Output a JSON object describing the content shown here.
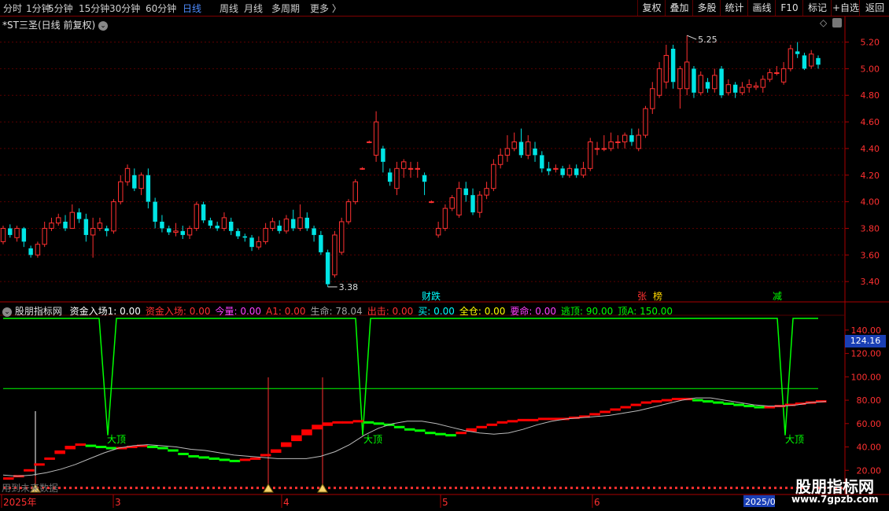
{
  "toolbar": {
    "left_tabs": [
      {
        "label": "分时",
        "active": false
      },
      {
        "label": "1分钟",
        "active": false
      },
      {
        "label": "5分钟",
        "active": false
      },
      {
        "label": "15分钟",
        "active": false
      },
      {
        "label": "30分钟",
        "active": false
      },
      {
        "label": "60分钟",
        "active": false
      },
      {
        "label": "日线",
        "active": true
      },
      {
        "label": "周线",
        "active": false
      },
      {
        "label": "月线",
        "active": false
      },
      {
        "label": "多周期",
        "active": false
      },
      {
        "label": "更多 〉",
        "active": false
      }
    ],
    "right_buttons": [
      "复权",
      "叠加",
      "多股",
      "统计",
      "画线",
      "F10",
      "标记",
      "+自选",
      "返回"
    ]
  },
  "stock": {
    "title": "*ST三圣(日线 前复权)",
    "high_label": "5.25",
    "low_label": "3.38",
    "price_ticks": [
      "5.20",
      "5.00",
      "4.80",
      "4.60",
      "4.40",
      "4.20",
      "4.00",
      "3.80",
      "3.60",
      "3.40"
    ]
  },
  "event_markers": [
    {
      "label": "财",
      "color": "#00ffff"
    },
    {
      "label": "跌",
      "color": "#00ffff"
    },
    {
      "label": "张",
      "color": "#ff3030"
    },
    {
      "label": "榜",
      "color": "#ffd700"
    },
    {
      "label": "减",
      "color": "#00ff00"
    }
  ],
  "indicator": {
    "name": "股朋指标网",
    "fields": [
      {
        "label": "资金入场1: 0.00",
        "color": "#ffffff"
      },
      {
        "label": "资金入场: 0.00",
        "color": "#ff3030"
      },
      {
        "label": "今量: 0.00",
        "color": "#ff40ff"
      },
      {
        "label": "A1: 0.00",
        "color": "#ff3030"
      },
      {
        "label": "生命: 78.04",
        "color": "#a0a0a0"
      },
      {
        "label": "出击: 0.00",
        "color": "#ff3030"
      },
      {
        "label": "买: 0.00",
        "color": "#00ffff"
      },
      {
        "label": "全仓: 0.00",
        "color": "#ffff00"
      },
      {
        "label": "要命: 0.00",
        "color": "#ff40ff"
      },
      {
        "label": "逃顶: 90.00",
        "color": "#00ff00"
      },
      {
        "label": "顶A: 150.00",
        "color": "#00ff00"
      }
    ],
    "value_ticks": [
      "140.00",
      "120.00",
      "100.00",
      "80.00",
      "60.00",
      "40.00",
      "20.00"
    ],
    "current_value": "124.16",
    "top_signal_label": "大顶"
  },
  "time_axis": {
    "labels": [
      "2025年",
      "3",
      "4",
      "5",
      "6"
    ],
    "right_label": "2025/0",
    "hint_text": "用到未来数据"
  },
  "watermark": {
    "title": "股朋指标网",
    "url": "www.7gpzb.com"
  },
  "colors": {
    "up": "#ff3030",
    "down": "#00e5e5",
    "indicator_up": "#ff0000",
    "indicator_down": "#00ff00",
    "frame": "#aa0000",
    "active_tab": "#4f8cff"
  },
  "chart_data": {
    "type": "candlestick",
    "title": "*ST三圣(日线 前复权)",
    "ylim": [
      3.33,
      5.28
    ],
    "candles": [
      [
        3.7,
        3.8,
        3.82,
        3.68
      ],
      [
        3.8,
        3.75,
        3.83,
        3.73
      ],
      [
        3.73,
        3.8,
        3.82,
        3.7
      ],
      [
        3.8,
        3.7,
        3.81,
        3.66
      ],
      [
        3.65,
        3.6,
        3.67,
        3.58
      ],
      [
        3.6,
        3.68,
        3.7,
        3.58
      ],
      [
        3.68,
        3.8,
        3.85,
        3.66
      ],
      [
        3.8,
        3.84,
        3.88,
        3.78
      ],
      [
        3.84,
        3.88,
        3.91,
        3.82
      ],
      [
        3.85,
        3.8,
        3.9,
        3.78
      ],
      [
        3.8,
        3.92,
        3.98,
        3.8
      ],
      [
        3.92,
        3.87,
        3.95,
        3.84
      ],
      [
        3.87,
        3.75,
        3.91,
        3.7
      ],
      [
        3.75,
        3.8,
        3.88,
        3.58
      ],
      [
        3.8,
        3.84,
        3.88,
        3.78
      ],
      [
        3.8,
        3.78,
        3.82,
        3.74
      ],
      [
        3.78,
        4.0,
        4.02,
        3.76
      ],
      [
        4.0,
        4.15,
        4.2,
        3.98
      ],
      [
        4.15,
        4.25,
        4.28,
        4.12
      ],
      [
        4.2,
        4.1,
        4.25,
        4.08
      ],
      [
        4.1,
        4.2,
        4.22,
        4.05
      ],
      [
        4.2,
        4.0,
        4.25,
        3.95
      ],
      [
        4.0,
        3.85,
        4.03,
        3.8
      ],
      [
        3.85,
        3.8,
        3.9,
        3.77
      ],
      [
        3.8,
        3.77,
        3.82,
        3.75
      ],
      [
        3.77,
        3.78,
        3.84,
        3.74
      ],
      [
        3.78,
        3.75,
        3.82,
        3.72
      ],
      [
        3.75,
        3.8,
        3.82,
        3.72
      ],
      [
        3.8,
        3.98,
        4.0,
        3.78
      ],
      [
        3.98,
        3.86,
        4.0,
        3.84
      ],
      [
        3.86,
        3.82,
        3.88,
        3.8
      ],
      [
        3.82,
        3.8,
        3.85,
        3.78
      ],
      [
        3.8,
        3.88,
        3.92,
        3.78
      ],
      [
        3.85,
        3.78,
        3.88,
        3.75
      ],
      [
        3.78,
        3.74,
        3.8,
        3.72
      ],
      [
        3.74,
        3.73,
        3.76,
        3.7
      ],
      [
        3.73,
        3.66,
        3.75,
        3.63
      ],
      [
        3.66,
        3.7,
        3.74,
        3.64
      ],
      [
        3.7,
        3.8,
        3.84,
        3.68
      ],
      [
        3.8,
        3.85,
        3.88,
        3.78
      ],
      [
        3.82,
        3.78,
        3.86,
        3.76
      ],
      [
        3.78,
        3.87,
        3.9,
        3.76
      ],
      [
        3.87,
        3.8,
        3.94,
        3.78
      ],
      [
        3.8,
        3.88,
        3.98,
        3.78
      ],
      [
        3.88,
        3.8,
        3.92,
        3.78
      ],
      [
        3.8,
        3.75,
        3.82,
        3.7
      ],
      [
        3.75,
        3.62,
        3.78,
        3.6
      ],
      [
        3.62,
        3.38,
        3.64,
        3.36
      ],
      [
        3.45,
        3.75,
        3.78,
        3.43
      ],
      [
        3.62,
        3.85,
        3.88,
        3.6
      ],
      [
        3.85,
        4.0,
        4.02,
        3.83
      ],
      [
        4.0,
        4.15,
        4.17,
        3.98
      ],
      [
        4.25,
        4.25,
        4.26,
        4.24
      ],
      [
        4.45,
        4.45,
        4.46,
        4.44
      ],
      [
        4.35,
        4.6,
        4.68,
        4.3
      ],
      [
        4.4,
        4.3,
        4.42,
        4.22
      ],
      [
        4.22,
        4.15,
        4.25,
        4.12
      ],
      [
        4.1,
        4.25,
        4.3,
        4.05
      ],
      [
        4.25,
        4.3,
        4.32,
        4.18
      ],
      [
        4.25,
        4.25,
        4.3,
        4.18
      ],
      [
        4.25,
        4.25,
        4.3,
        4.18
      ],
      [
        4.2,
        4.15,
        4.22,
        4.05
      ],
      [
        4.0,
        4.0,
        4.01,
        3.99
      ],
      [
        3.75,
        3.8,
        3.85,
        3.73
      ],
      [
        3.8,
        3.95,
        3.98,
        3.78
      ],
      [
        3.95,
        4.03,
        4.05,
        3.93
      ],
      [
        3.9,
        4.1,
        4.15,
        3.88
      ],
      [
        4.1,
        4.05,
        4.15,
        4.0
      ],
      [
        4.05,
        3.92,
        4.1,
        3.9
      ],
      [
        3.92,
        4.05,
        4.08,
        3.88
      ],
      [
        4.05,
        4.1,
        4.15,
        4.02
      ],
      [
        4.1,
        4.28,
        4.32,
        4.08
      ],
      [
        4.28,
        4.35,
        4.4,
        4.25
      ],
      [
        4.35,
        4.4,
        4.5,
        4.3
      ],
      [
        4.4,
        4.45,
        4.52,
        4.38
      ],
      [
        4.45,
        4.35,
        4.55,
        4.33
      ],
      [
        4.35,
        4.45,
        4.5,
        4.32
      ],
      [
        4.4,
        4.35,
        4.45,
        4.3
      ],
      [
        4.35,
        4.25,
        4.38,
        4.22
      ],
      [
        4.25,
        4.23,
        4.3,
        4.2
      ],
      [
        4.25,
        4.25,
        4.28,
        4.22
      ],
      [
        4.25,
        4.2,
        4.27,
        4.18
      ],
      [
        4.2,
        4.25,
        4.28,
        4.18
      ],
      [
        4.25,
        4.2,
        4.28,
        4.18
      ],
      [
        4.2,
        4.25,
        4.3,
        4.18
      ],
      [
        4.25,
        4.45,
        4.48,
        4.23
      ],
      [
        4.4,
        4.4,
        4.45,
        4.35
      ],
      [
        4.4,
        4.4,
        4.5,
        4.38
      ],
      [
        4.4,
        4.45,
        4.52,
        4.38
      ],
      [
        4.45,
        4.45,
        4.5,
        4.4
      ],
      [
        4.45,
        4.5,
        4.52,
        4.4
      ],
      [
        4.5,
        4.45,
        4.55,
        4.42
      ],
      [
        4.4,
        4.5,
        4.55,
        4.38
      ],
      [
        4.5,
        4.7,
        4.72,
        4.48
      ],
      [
        4.7,
        4.85,
        4.9,
        4.66
      ],
      [
        4.8,
        5.0,
        5.05,
        4.78
      ],
      [
        4.9,
        5.1,
        5.18,
        4.85
      ],
      [
        5.15,
        4.9,
        5.18,
        4.85
      ],
      [
        4.85,
        5.0,
        5.02,
        4.7
      ],
      [
        4.85,
        5.05,
        5.25,
        4.8
      ],
      [
        5.0,
        4.82,
        5.02,
        4.78
      ],
      [
        4.82,
        4.95,
        4.98,
        4.8
      ],
      [
        4.9,
        4.85,
        4.93,
        4.82
      ],
      [
        4.85,
        4.95,
        5.0,
        4.82
      ],
      [
        5.0,
        4.8,
        5.02,
        4.78
      ],
      [
        4.82,
        4.88,
        4.92,
        4.8
      ],
      [
        4.88,
        4.82,
        4.9,
        4.78
      ],
      [
        4.82,
        4.86,
        4.9,
        4.8
      ],
      [
        4.86,
        4.88,
        4.92,
        4.82
      ],
      [
        4.86,
        4.87,
        4.9,
        4.84
      ],
      [
        4.86,
        4.92,
        4.95,
        4.82
      ],
      [
        4.92,
        4.97,
        5.0,
        4.9
      ],
      [
        4.97,
        4.97,
        5.02,
        4.95
      ],
      [
        4.9,
        5.0,
        5.05,
        4.88
      ],
      [
        5.0,
        5.15,
        5.18,
        4.98
      ],
      [
        5.13,
        5.11,
        5.2,
        5.08
      ],
      [
        5.1,
        5.0,
        5.12,
        4.99
      ],
      [
        5.02,
        5.11,
        5.14,
        5.0
      ],
      [
        5.08,
        5.03,
        5.1,
        5.0
      ]
    ],
    "indicator_ylim": [
      0,
      150
    ],
    "indicator_step": [
      [
        14,
        14
      ],
      [
        16,
        16
      ],
      [
        20,
        21
      ],
      [
        24,
        26
      ],
      [
        29,
        31
      ],
      [
        34,
        37
      ],
      [
        38,
        41
      ],
      [
        42,
        43
      ],
      [
        41,
        42
      ],
      [
        40,
        41
      ],
      [
        39,
        40
      ],
      [
        38,
        40
      ],
      [
        40,
        41
      ],
      [
        41,
        42
      ],
      [
        40,
        41
      ],
      [
        39,
        40
      ],
      [
        37,
        38
      ],
      [
        34,
        35
      ],
      [
        32,
        33
      ],
      [
        31,
        32
      ],
      [
        30,
        31
      ],
      [
        29,
        30
      ],
      [
        28,
        29
      ],
      [
        29,
        30
      ],
      [
        30,
        31
      ],
      [
        32,
        34
      ],
      [
        35,
        38
      ],
      [
        40,
        44
      ],
      [
        45,
        50
      ],
      [
        50,
        55
      ],
      [
        55,
        59
      ],
      [
        58,
        61
      ],
      [
        60,
        62
      ],
      [
        61,
        62
      ],
      [
        62,
        63
      ],
      [
        61,
        62
      ],
      [
        60,
        61
      ],
      [
        59,
        60
      ],
      [
        57,
        58
      ],
      [
        55,
        56
      ],
      [
        54,
        55
      ],
      [
        52,
        53
      ],
      [
        51,
        52
      ],
      [
        50,
        51
      ],
      [
        51,
        53
      ],
      [
        53,
        56
      ],
      [
        56,
        58
      ],
      [
        58,
        60
      ],
      [
        60,
        62
      ],
      [
        62,
        63
      ],
      [
        63,
        64
      ],
      [
        63,
        64
      ],
      [
        64,
        65
      ],
      [
        64,
        65
      ],
      [
        64,
        65
      ],
      [
        65,
        66
      ],
      [
        66,
        67
      ],
      [
        67,
        69
      ],
      [
        69,
        71
      ],
      [
        71,
        73
      ],
      [
        73,
        75
      ],
      [
        75,
        77
      ],
      [
        77,
        79
      ],
      [
        79,
        80
      ],
      [
        80,
        81
      ],
      [
        81,
        82
      ],
      [
        81,
        82
      ],
      [
        80,
        81
      ],
      [
        79,
        80
      ],
      [
        78,
        79
      ],
      [
        77,
        78
      ],
      [
        76,
        77
      ],
      [
        75,
        76
      ],
      [
        74,
        75
      ],
      [
        74,
        75
      ],
      [
        75,
        76
      ],
      [
        76,
        77
      ],
      [
        77,
        78
      ],
      [
        78,
        79
      ],
      [
        79,
        80
      ]
    ],
    "life_line": [
      16,
      15,
      16,
      18,
      21,
      25,
      30,
      35,
      39,
      41,
      42,
      41,
      40,
      38,
      37,
      35,
      33,
      32,
      31,
      30,
      30,
      30,
      32,
      36,
      42,
      50,
      56,
      60,
      62,
      62,
      60,
      57,
      54,
      52,
      51,
      52,
      55,
      59,
      62,
      64,
      65,
      66,
      67,
      69,
      71,
      74,
      77,
      80,
      82,
      82,
      80,
      78,
      76,
      75,
      75,
      76,
      78,
      79
    ],
    "signal_line_value": 150,
    "escape_value": 90,
    "big_top_dips_value": 50,
    "bottom_dashes_value": 5
  }
}
